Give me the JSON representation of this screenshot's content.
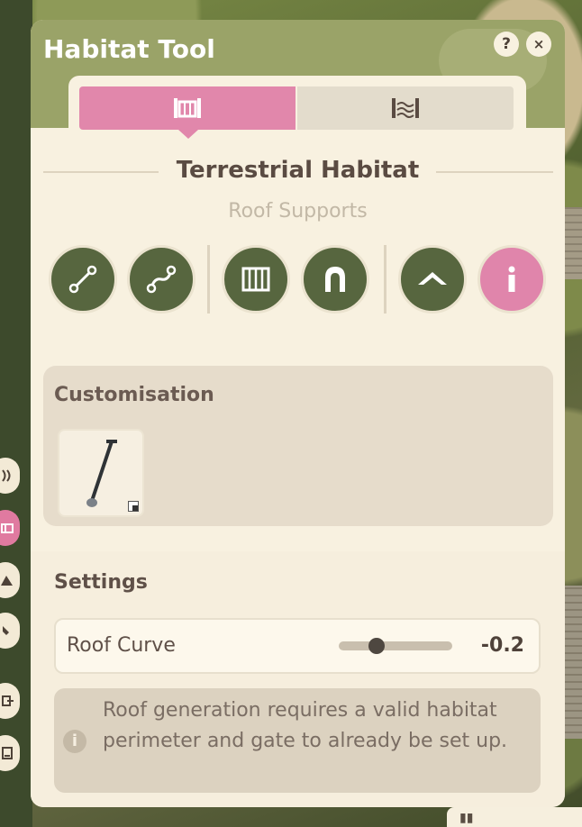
{
  "window": {
    "title": "Habitat Tool",
    "help_label": "?",
    "close_label": "×"
  },
  "tabs": [
    {
      "name": "habitat-walls-tab",
      "icon": "fence-icon",
      "active": true
    },
    {
      "name": "habitat-terrain-tab",
      "icon": "wave-fence-icon",
      "active": false
    }
  ],
  "section": {
    "title": "Terrestrial Habitat",
    "subtitle": "Roof Supports"
  },
  "tools": [
    {
      "icon": "straight-line-icon"
    },
    {
      "icon": "curve-line-icon"
    },
    {
      "icon": "barrier-panel-icon"
    },
    {
      "icon": "gate-arch-icon"
    },
    {
      "icon": "roof-icon"
    },
    {
      "icon": "info-icon",
      "active": true
    }
  ],
  "customisation": {
    "title": "Customisation",
    "item_icon": "roof-support-pole-icon"
  },
  "settings": {
    "title": "Settings",
    "roof_curve_label": "Roof Curve",
    "roof_curve_value": "-0.2",
    "roof_curve_fraction": 0.33
  },
  "note": {
    "icon": "info-icon",
    "text": "Roof generation requires a valid habitat perimeter and gate to already be set up."
  },
  "sidebar_icons": [
    "terrain-icon",
    "habitat-icon",
    "mountain-icon",
    "paint-icon",
    "export-icon",
    "document-icon"
  ],
  "colors": {
    "header": "#9aa368",
    "accent_pink": "#e187ab",
    "tool_green": "#57663f",
    "panel": "#f8f1e0"
  }
}
